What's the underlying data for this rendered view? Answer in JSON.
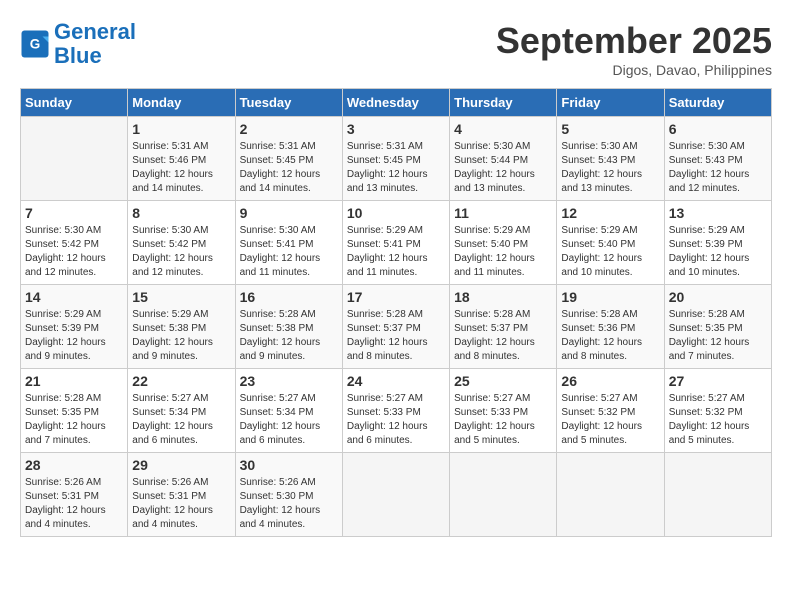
{
  "header": {
    "logo_line1": "General",
    "logo_line2": "Blue",
    "month": "September 2025",
    "location": "Digos, Davao, Philippines"
  },
  "days_of_week": [
    "Sunday",
    "Monday",
    "Tuesday",
    "Wednesday",
    "Thursday",
    "Friday",
    "Saturday"
  ],
  "weeks": [
    [
      {
        "num": "",
        "info": ""
      },
      {
        "num": "1",
        "info": "Sunrise: 5:31 AM\nSunset: 5:46 PM\nDaylight: 12 hours\nand 14 minutes."
      },
      {
        "num": "2",
        "info": "Sunrise: 5:31 AM\nSunset: 5:45 PM\nDaylight: 12 hours\nand 14 minutes."
      },
      {
        "num": "3",
        "info": "Sunrise: 5:31 AM\nSunset: 5:45 PM\nDaylight: 12 hours\nand 13 minutes."
      },
      {
        "num": "4",
        "info": "Sunrise: 5:30 AM\nSunset: 5:44 PM\nDaylight: 12 hours\nand 13 minutes."
      },
      {
        "num": "5",
        "info": "Sunrise: 5:30 AM\nSunset: 5:43 PM\nDaylight: 12 hours\nand 13 minutes."
      },
      {
        "num": "6",
        "info": "Sunrise: 5:30 AM\nSunset: 5:43 PM\nDaylight: 12 hours\nand 12 minutes."
      }
    ],
    [
      {
        "num": "7",
        "info": "Sunrise: 5:30 AM\nSunset: 5:42 PM\nDaylight: 12 hours\nand 12 minutes."
      },
      {
        "num": "8",
        "info": "Sunrise: 5:30 AM\nSunset: 5:42 PM\nDaylight: 12 hours\nand 12 minutes."
      },
      {
        "num": "9",
        "info": "Sunrise: 5:30 AM\nSunset: 5:41 PM\nDaylight: 12 hours\nand 11 minutes."
      },
      {
        "num": "10",
        "info": "Sunrise: 5:29 AM\nSunset: 5:41 PM\nDaylight: 12 hours\nand 11 minutes."
      },
      {
        "num": "11",
        "info": "Sunrise: 5:29 AM\nSunset: 5:40 PM\nDaylight: 12 hours\nand 11 minutes."
      },
      {
        "num": "12",
        "info": "Sunrise: 5:29 AM\nSunset: 5:40 PM\nDaylight: 12 hours\nand 10 minutes."
      },
      {
        "num": "13",
        "info": "Sunrise: 5:29 AM\nSunset: 5:39 PM\nDaylight: 12 hours\nand 10 minutes."
      }
    ],
    [
      {
        "num": "14",
        "info": "Sunrise: 5:29 AM\nSunset: 5:39 PM\nDaylight: 12 hours\nand 9 minutes."
      },
      {
        "num": "15",
        "info": "Sunrise: 5:29 AM\nSunset: 5:38 PM\nDaylight: 12 hours\nand 9 minutes."
      },
      {
        "num": "16",
        "info": "Sunrise: 5:28 AM\nSunset: 5:38 PM\nDaylight: 12 hours\nand 9 minutes."
      },
      {
        "num": "17",
        "info": "Sunrise: 5:28 AM\nSunset: 5:37 PM\nDaylight: 12 hours\nand 8 minutes."
      },
      {
        "num": "18",
        "info": "Sunrise: 5:28 AM\nSunset: 5:37 PM\nDaylight: 12 hours\nand 8 minutes."
      },
      {
        "num": "19",
        "info": "Sunrise: 5:28 AM\nSunset: 5:36 PM\nDaylight: 12 hours\nand 8 minutes."
      },
      {
        "num": "20",
        "info": "Sunrise: 5:28 AM\nSunset: 5:35 PM\nDaylight: 12 hours\nand 7 minutes."
      }
    ],
    [
      {
        "num": "21",
        "info": "Sunrise: 5:28 AM\nSunset: 5:35 PM\nDaylight: 12 hours\nand 7 minutes."
      },
      {
        "num": "22",
        "info": "Sunrise: 5:27 AM\nSunset: 5:34 PM\nDaylight: 12 hours\nand 6 minutes."
      },
      {
        "num": "23",
        "info": "Sunrise: 5:27 AM\nSunset: 5:34 PM\nDaylight: 12 hours\nand 6 minutes."
      },
      {
        "num": "24",
        "info": "Sunrise: 5:27 AM\nSunset: 5:33 PM\nDaylight: 12 hours\nand 6 minutes."
      },
      {
        "num": "25",
        "info": "Sunrise: 5:27 AM\nSunset: 5:33 PM\nDaylight: 12 hours\nand 5 minutes."
      },
      {
        "num": "26",
        "info": "Sunrise: 5:27 AM\nSunset: 5:32 PM\nDaylight: 12 hours\nand 5 minutes."
      },
      {
        "num": "27",
        "info": "Sunrise: 5:27 AM\nSunset: 5:32 PM\nDaylight: 12 hours\nand 5 minutes."
      }
    ],
    [
      {
        "num": "28",
        "info": "Sunrise: 5:26 AM\nSunset: 5:31 PM\nDaylight: 12 hours\nand 4 minutes."
      },
      {
        "num": "29",
        "info": "Sunrise: 5:26 AM\nSunset: 5:31 PM\nDaylight: 12 hours\nand 4 minutes."
      },
      {
        "num": "30",
        "info": "Sunrise: 5:26 AM\nSunset: 5:30 PM\nDaylight: 12 hours\nand 4 minutes."
      },
      {
        "num": "",
        "info": ""
      },
      {
        "num": "",
        "info": ""
      },
      {
        "num": "",
        "info": ""
      },
      {
        "num": "",
        "info": ""
      }
    ]
  ]
}
